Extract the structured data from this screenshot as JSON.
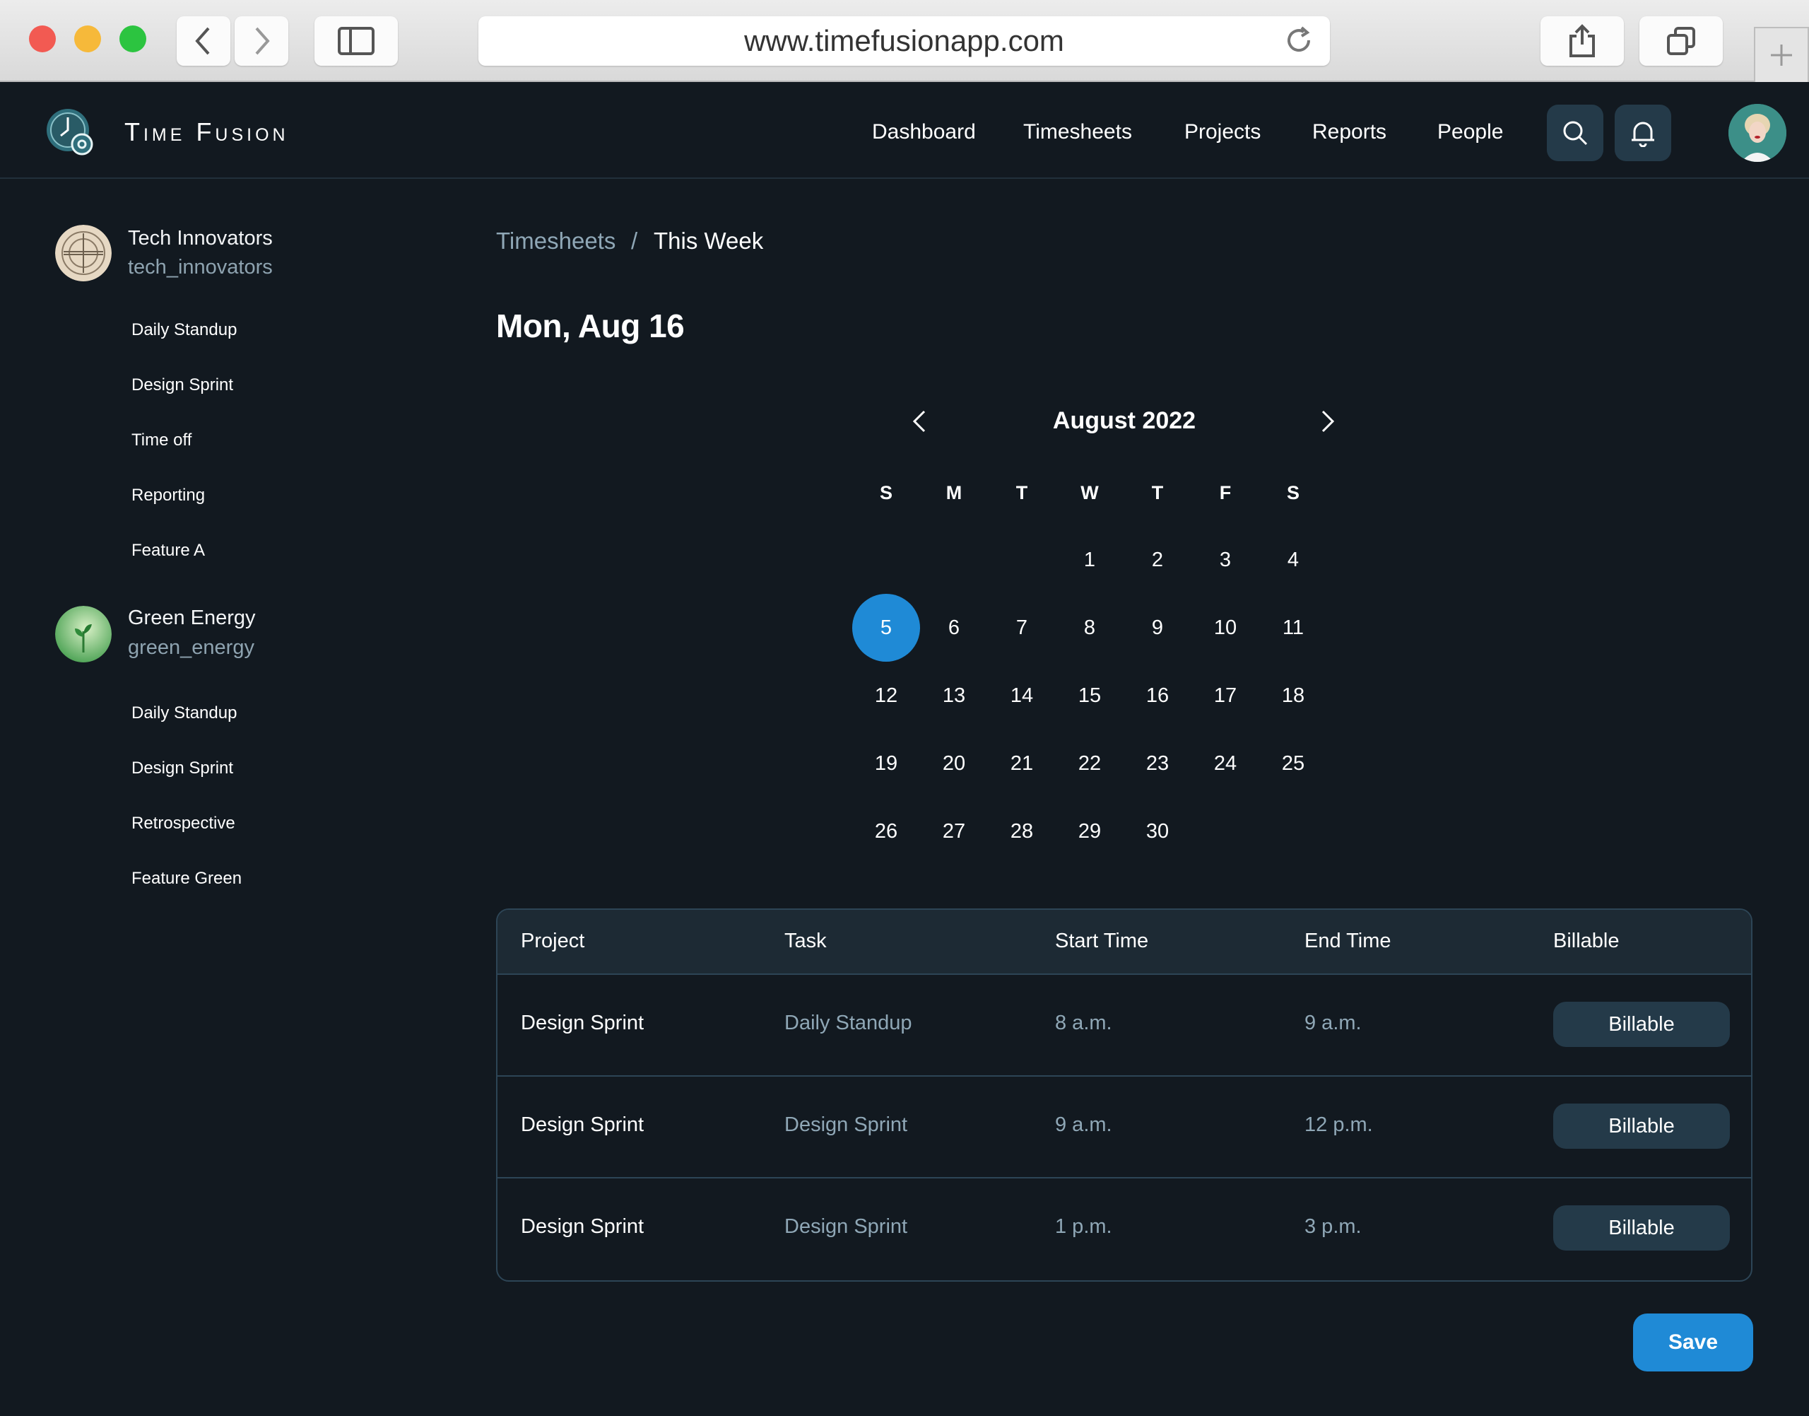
{
  "browser": {
    "url": "www.timefusionapp.com",
    "icons": [
      "back-icon",
      "forward-icon",
      "sidebar-icon",
      "reload-icon",
      "share-icon",
      "tabs-icon",
      "new-tab-icon"
    ]
  },
  "header": {
    "brand": "Time Fusion",
    "nav": [
      "Dashboard",
      "Timesheets",
      "Projects",
      "Reports",
      "People"
    ],
    "icons": [
      "search-icon",
      "bell-icon"
    ]
  },
  "sidebar": {
    "orgs": [
      {
        "name": "Tech Innovators",
        "handle": "tech_innovators",
        "items": [
          "Daily Standup",
          "Design Sprint",
          "Time off",
          "Reporting",
          "Feature A"
        ]
      },
      {
        "name": "Green Energy",
        "handle": "green_energy",
        "items": [
          "Daily Standup",
          "Design Sprint",
          "Retrospective",
          "Feature Green"
        ]
      }
    ]
  },
  "main": {
    "breadcrumb": {
      "parent": "Timesheets",
      "separator": "/",
      "current": "This Week"
    },
    "title": "Mon, Aug 16",
    "calendar": {
      "month_label": "August 2022",
      "weekdays": [
        "S",
        "M",
        "T",
        "W",
        "T",
        "F",
        "S"
      ],
      "first_weekday_index": 3,
      "days_in_month": 30,
      "selected_day": 5
    },
    "table": {
      "columns": [
        "Project",
        "Task",
        "Start Time",
        "End Time",
        "Billable"
      ],
      "rows": [
        {
          "project": "Design Sprint",
          "task": "Daily Standup",
          "start": "8 a.m.",
          "end": "9 a.m.",
          "billable": "Billable"
        },
        {
          "project": "Design Sprint",
          "task": "Design Sprint",
          "start": "9 a.m.",
          "end": "12 p.m.",
          "billable": "Billable"
        },
        {
          "project": "Design Sprint",
          "task": "Design Sprint",
          "start": "1 p.m.",
          "end": "3 p.m.",
          "billable": "Billable"
        }
      ]
    },
    "save_label": "Save"
  },
  "colors": {
    "background": "#121920",
    "accent": "#1f8ad6",
    "muted_text": "#8fa7b6",
    "button_bg": "#243a49",
    "border": "#2d4556"
  }
}
